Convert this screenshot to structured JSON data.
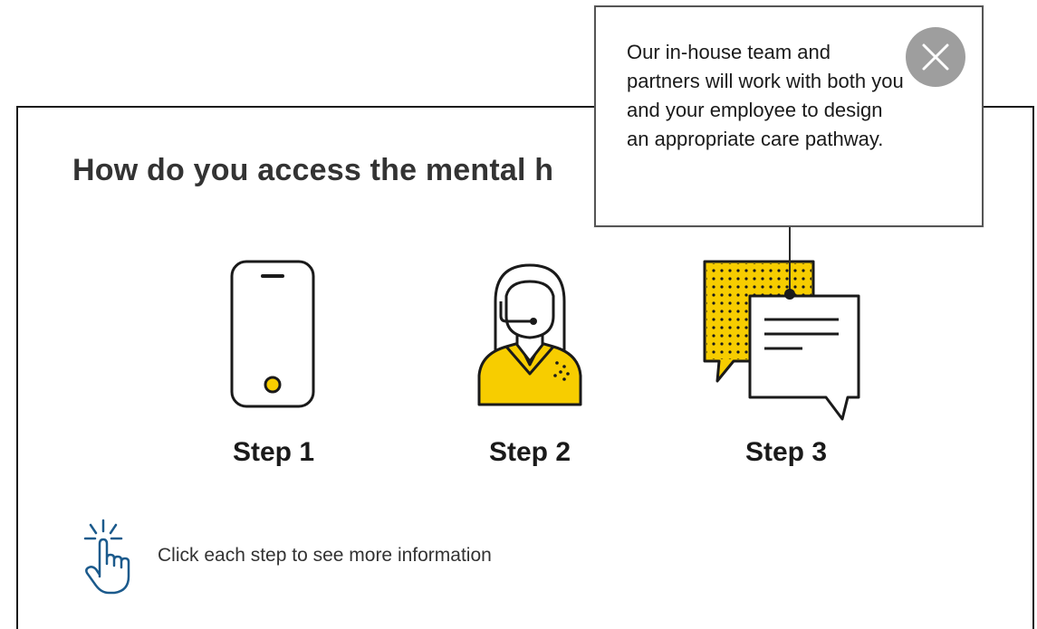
{
  "heading": {
    "title": "How do you access the mental h"
  },
  "steps": [
    {
      "label": "Step 1",
      "icon": "smartphone-icon"
    },
    {
      "label": "Step 2",
      "icon": "support-agent-icon"
    },
    {
      "label": "Step 3",
      "icon": "chat-bubbles-icon"
    }
  ],
  "hint": {
    "icon": "tap-hand-icon",
    "text": "Click each step to see more information"
  },
  "tooltip": {
    "text": "Our in-house team and partners will work with both you and your employee to design an appropriate care pathway.",
    "close_icon": "close-icon"
  },
  "colors": {
    "accent_yellow": "#F7CD00",
    "line_dark": "#1A1A1A",
    "hint_blue": "#1B5A8C",
    "close_grey": "#9E9E9E"
  }
}
